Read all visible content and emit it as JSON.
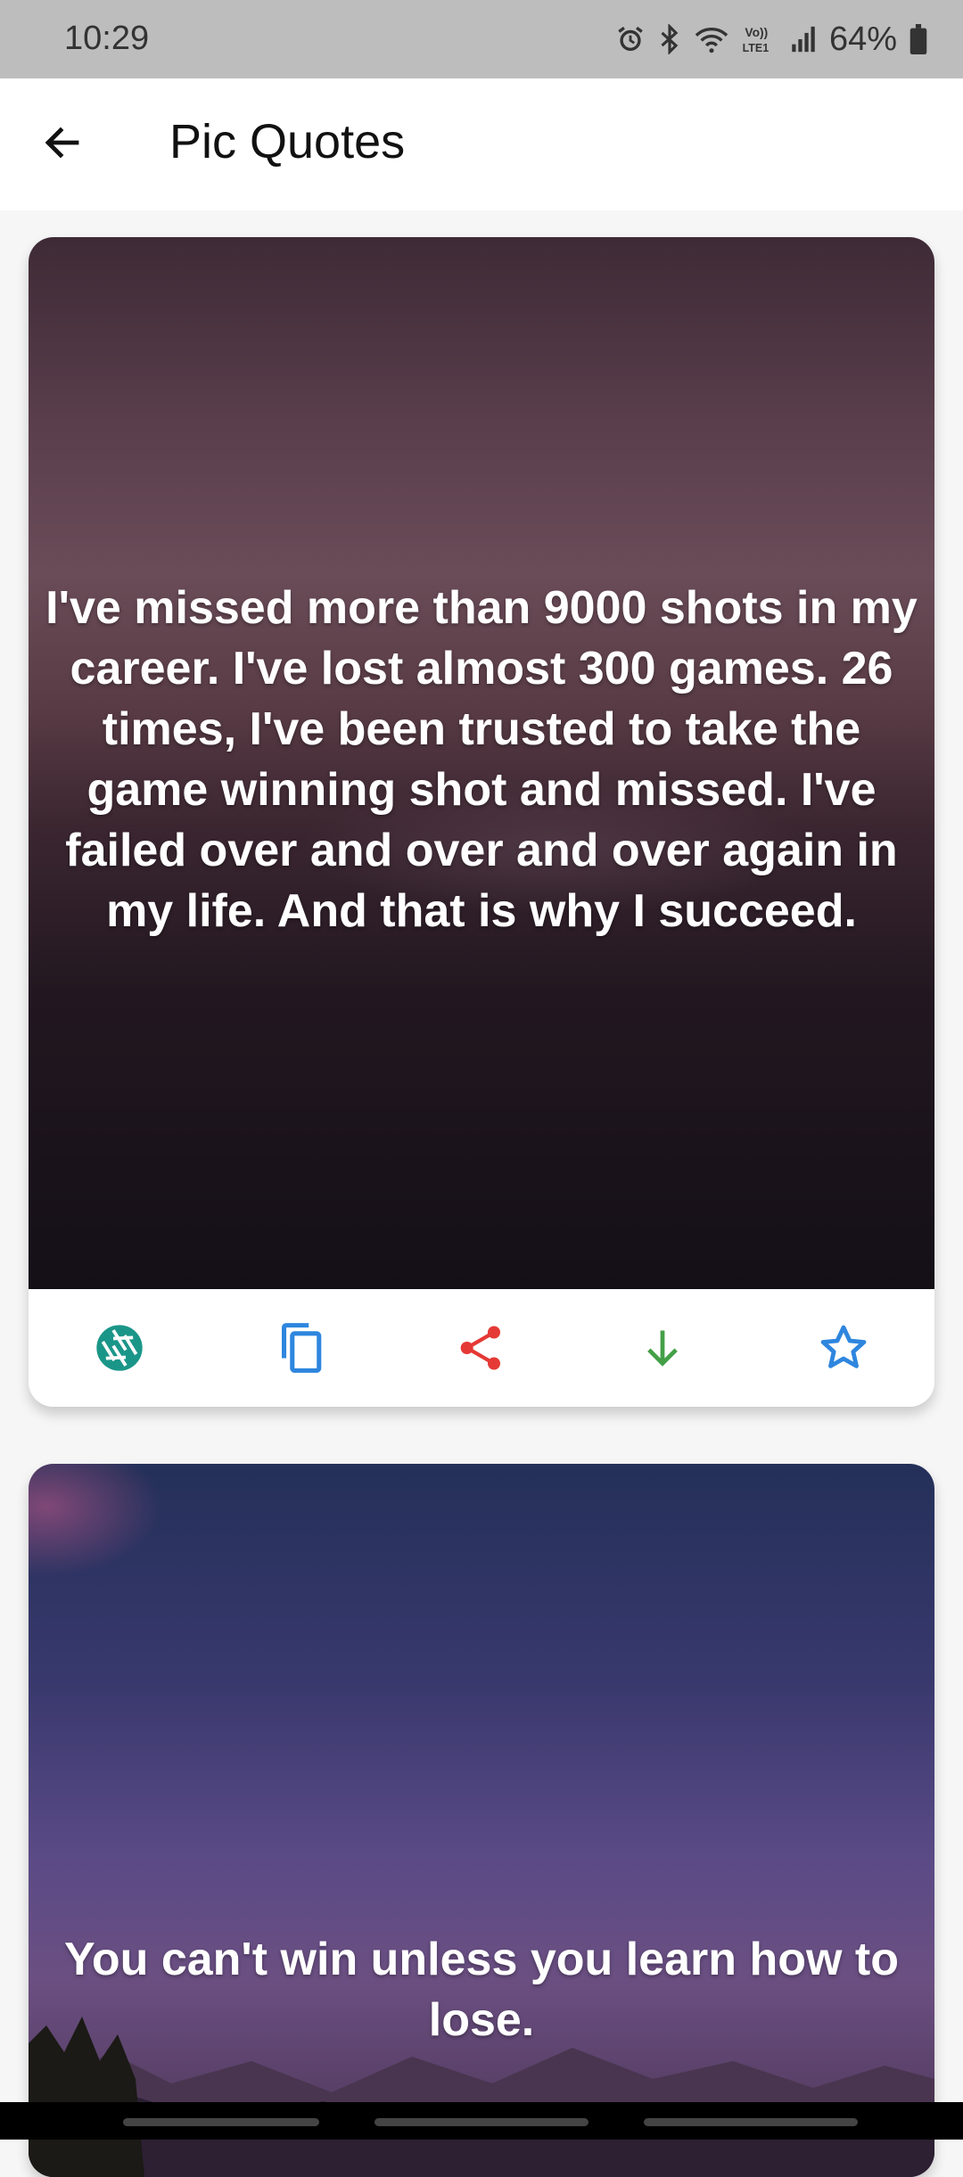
{
  "status_bar": {
    "time": "10:29",
    "battery": "64%",
    "icons": [
      "alarm-icon",
      "bluetooth-icon",
      "wifi-icon",
      "volte-lte-icon",
      "signal-icon",
      "battery-icon"
    ],
    "volte_label": "Vo)) LTE1"
  },
  "app_bar": {
    "back_icon": "arrow-left-icon",
    "title": "Pic Quotes"
  },
  "quotes": [
    {
      "text": "I've missed more than 9000 shots in my career. I've lost almost 300 games. 26 times, I've been trusted to take the game winning shot and missed. I've failed over and over and over again in my life. And that is why I succeed."
    },
    {
      "text": "You can't win unless you learn how to lose."
    }
  ],
  "actions": [
    {
      "name": "camera-aperture-icon",
      "color": "#1a9688"
    },
    {
      "name": "copy-icon",
      "color": "#2e86de"
    },
    {
      "name": "share-icon",
      "color": "#e53935"
    },
    {
      "name": "download-arrow-icon",
      "color": "#43a047"
    },
    {
      "name": "star-outline-icon",
      "color": "#2e86de"
    }
  ]
}
